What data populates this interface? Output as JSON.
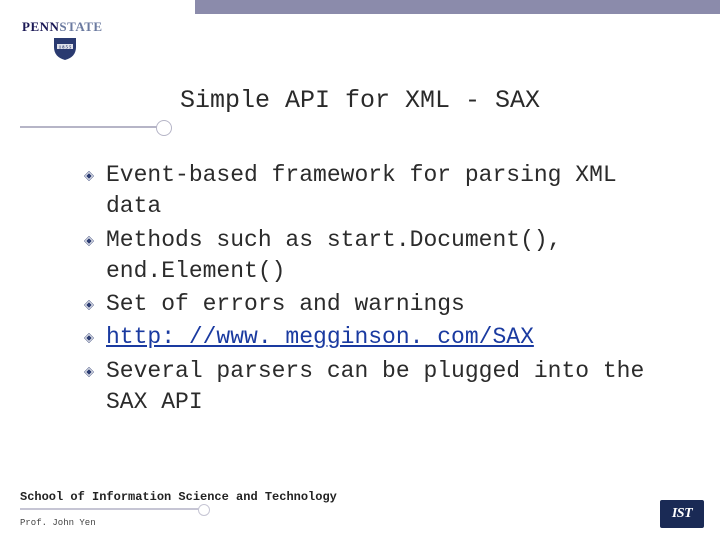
{
  "logo": {
    "text_dark": "PENN",
    "text_light": "STATE",
    "shield_year": "1855"
  },
  "title": "Simple API for XML - SAX",
  "bullets": [
    {
      "text": "Event-based framework for parsing XML data",
      "link": false
    },
    {
      "text": "Methods such as start.Document(), end.Element()",
      "link": false
    },
    {
      "text": "Set of errors and warnings",
      "link": false
    },
    {
      "text": "http: //www. megginson. com/SAX",
      "link": true
    },
    {
      "text": "Several parsers can be plugged into the SAX API",
      "link": false
    }
  ],
  "footer": {
    "school": "School of Information Science and Technology",
    "prof": "Prof. John Yen",
    "ist": "IST"
  },
  "colors": {
    "bullet_fill": "#2a3a70"
  }
}
